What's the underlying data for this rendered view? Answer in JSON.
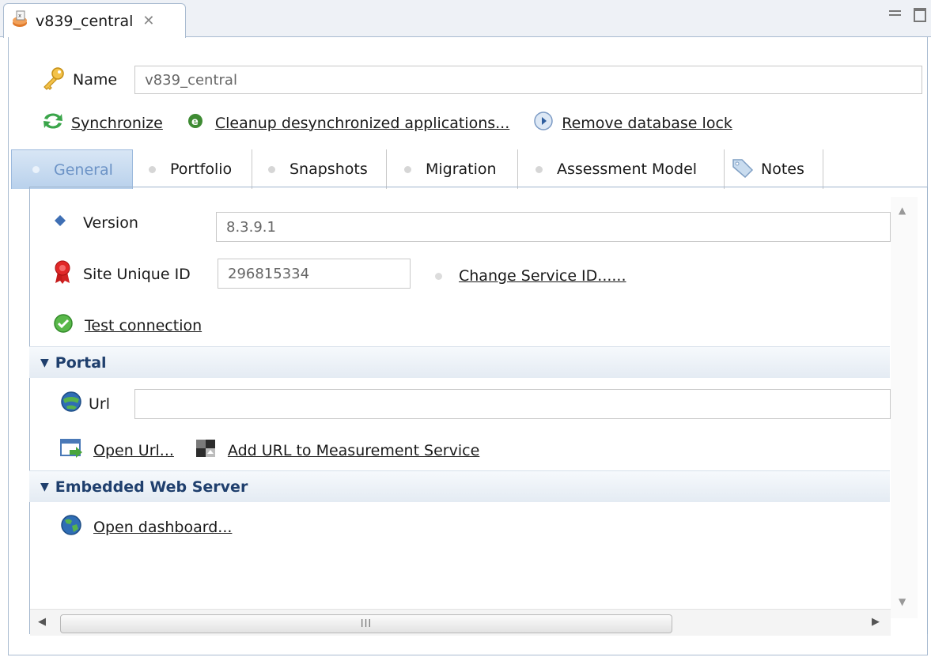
{
  "editor": {
    "tab_title": "v839_central",
    "close_glyph": "✕"
  },
  "header": {
    "name_label": "Name",
    "name_value": "v839_central",
    "actions": {
      "synchronize": "Synchronize",
      "cleanup": "Cleanup desynchronized applications...",
      "remove_lock": "Remove database lock"
    }
  },
  "tabs": [
    {
      "label": "General",
      "active": true
    },
    {
      "label": "Portfolio",
      "active": false
    },
    {
      "label": "Snapshots",
      "active": false
    },
    {
      "label": "Migration",
      "active": false
    },
    {
      "label": "Assessment Model",
      "active": false
    },
    {
      "label": "Notes",
      "active": false
    }
  ],
  "general": {
    "version_label": "Version",
    "version_value": "8.3.9.1",
    "site_id_label": "Site Unique ID",
    "site_id_value": "296815334",
    "change_service_id": "Change Service ID......",
    "test_connection": "Test connection"
  },
  "portal": {
    "title": "Portal",
    "url_label": "Url",
    "url_value": "",
    "open_url": "Open Url...",
    "add_url": "Add URL to Measurement Service"
  },
  "web_server": {
    "title": "Embedded Web Server",
    "open_dashboard": "Open dashboard..."
  },
  "scrollbar": {
    "thumb_grip": "III"
  },
  "colors": {
    "section_title": "#1f3f6d",
    "active_tab_text": "#6c93c6",
    "border": "#a9bbd0"
  },
  "icons": [
    "database-icon",
    "key-icon",
    "sync-icon",
    "cleanup-icon",
    "play-circle-icon",
    "diamond-icon",
    "ribbon-icon",
    "check-circle-icon",
    "globe-icon",
    "open-window-icon",
    "measurement-icon",
    "tag-icon"
  ]
}
